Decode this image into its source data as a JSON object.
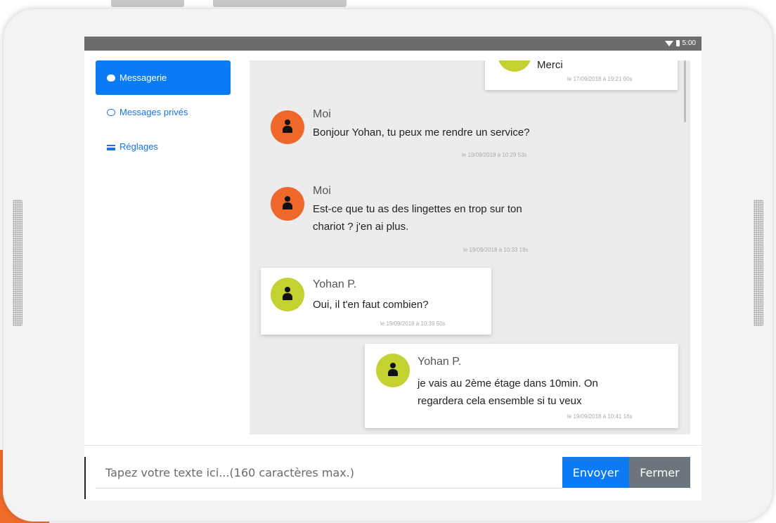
{
  "statusbar": {
    "time": "5:00"
  },
  "sidebar": {
    "items": [
      {
        "label": "Messagerie",
        "icon": "chat-icon",
        "active": true
      },
      {
        "label": "Messages privés",
        "icon": "comment-icon",
        "active": false
      },
      {
        "label": "Réglages",
        "icon": "sliders-icon",
        "active": false
      }
    ]
  },
  "messages": [
    {
      "author": "",
      "text": "Merci",
      "time": "le 17/09/2018 à 19:21 00s",
      "from": "yohan"
    },
    {
      "author": "Moi",
      "text": "Bonjour Yohan, tu peux me rendre un service?",
      "time": "le 19/09/2018 à 10:29 53s",
      "from": "me"
    },
    {
      "author": "Moi",
      "text_lines": [
        "Est-ce que tu as des lingettes en trop sur ton",
        "chariot ? j'en ai plus."
      ],
      "time": "le 19/09/2018 à 10:33 18s",
      "from": "me"
    },
    {
      "author": "Yohan P.",
      "text": "Oui, il t'en faut combien?",
      "time": "le 19/09/2018 à 10:39 50s",
      "from": "yohan"
    },
    {
      "author": "Yohan P.",
      "text_lines": [
        "je vais au 2ème étage dans 10min. On",
        "regardera cela ensemble si tu veux"
      ],
      "time": "le 19/09/2018 à 10:41 16s",
      "from": "yohan"
    }
  ],
  "composer": {
    "placeholder": "Tapez votre texte ici...(160 caractères max.)",
    "send_label": "Envoyer",
    "close_label": "Fermer"
  },
  "colors": {
    "primary": "#0a7bf5",
    "secondary": "#6c757d",
    "avatar_me": "#f0672a",
    "avatar_yohan": "#c4d231",
    "accent": "#ef6c2b"
  }
}
